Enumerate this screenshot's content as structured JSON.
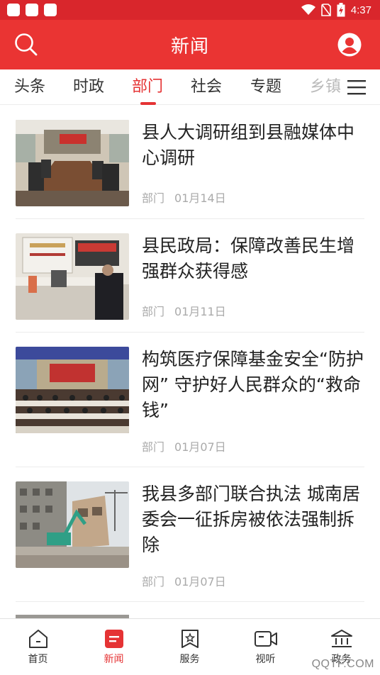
{
  "status_bar": {
    "time": "4:37"
  },
  "header": {
    "title": "新闻",
    "search_icon": "search-icon",
    "user_icon": "user-icon",
    "brand_color": "#ea3433"
  },
  "tabs": [
    {
      "label": "头条"
    },
    {
      "label": "时政"
    },
    {
      "label": "部门",
      "active": true
    },
    {
      "label": "社会"
    },
    {
      "label": "专题"
    },
    {
      "label": "乡镇"
    }
  ],
  "news": [
    {
      "title": "县人大调研组到县融媒体中心调研",
      "category": "部门",
      "date": "01月14日",
      "image": "meeting-room-photo"
    },
    {
      "title": "县民政局：保障改善民生增强群众获得感",
      "category": "部门",
      "date": "01月11日",
      "image": "service-counter-photo"
    },
    {
      "title": "构筑医疗保障基金安全“防护网” 守护好人民群众的“救命钱”",
      "category": "部门",
      "date": "01月07日",
      "image": "conference-hall-photo"
    },
    {
      "title": "我县多部门联合执法  城南居委会一征拆房被依法强制拆除",
      "category": "部门",
      "date": "01月07日",
      "image": "demolition-photo"
    }
  ],
  "bottom_nav": [
    {
      "label": "首页",
      "icon": "home-icon"
    },
    {
      "label": "新闻",
      "icon": "news-icon",
      "active": true
    },
    {
      "label": "服务",
      "icon": "service-icon"
    },
    {
      "label": "视听",
      "icon": "video-icon"
    },
    {
      "label": "政务",
      "icon": "government-icon"
    }
  ],
  "watermark": "QQTF.COM"
}
